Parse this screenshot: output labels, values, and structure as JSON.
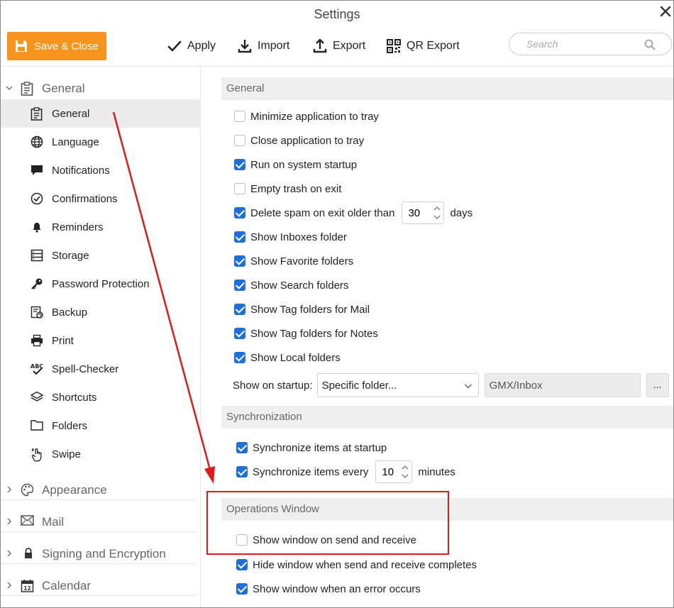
{
  "window": {
    "title": "Settings"
  },
  "toolbar": {
    "save_close": "Save & Close",
    "apply": "Apply",
    "import": "Import",
    "export": "Export",
    "qr_export": "QR Export"
  },
  "search": {
    "placeholder": "Search"
  },
  "colors": {
    "accent": "#f7941d",
    "checkbox": "#1e6fd9",
    "annotation": "#e0191b"
  },
  "sidebar": {
    "groups": [
      {
        "label": "General",
        "icon": "clipboard-icon",
        "expanded": true
      },
      {
        "label": "Appearance",
        "icon": "palette-icon",
        "expanded": false
      },
      {
        "label": "Mail",
        "icon": "envelope-icon",
        "expanded": false
      },
      {
        "label": "Signing and Encryption",
        "icon": "lock-icon",
        "expanded": false
      },
      {
        "label": "Calendar",
        "icon": "calendar-icon",
        "expanded": false
      }
    ],
    "items": [
      {
        "label": "General",
        "icon": "clipboard-icon",
        "selected": true
      },
      {
        "label": "Language",
        "icon": "globe-icon"
      },
      {
        "label": "Notifications",
        "icon": "speech-bubble-icon"
      },
      {
        "label": "Confirmations",
        "icon": "check-circle-icon"
      },
      {
        "label": "Reminders",
        "icon": "bell-icon"
      },
      {
        "label": "Storage",
        "icon": "storage-icon"
      },
      {
        "label": "Password Protection",
        "icon": "key-icon"
      },
      {
        "label": "Backup",
        "icon": "backup-icon"
      },
      {
        "label": "Print",
        "icon": "printer-icon"
      },
      {
        "label": "Spell-Checker",
        "icon": "spellcheck-icon"
      },
      {
        "label": "Shortcuts",
        "icon": "layers-icon"
      },
      {
        "label": "Folders",
        "icon": "folder-icon"
      },
      {
        "label": "Swipe",
        "icon": "swipe-hand-icon"
      }
    ],
    "calendar_icon_text": "12"
  },
  "general": {
    "heading": "General",
    "options": [
      {
        "label": "Minimize application to tray",
        "checked": false
      },
      {
        "label": "Close application to tray",
        "checked": false
      },
      {
        "label": "Run on system startup",
        "checked": true
      },
      {
        "label": "Empty trash on exit",
        "checked": false
      },
      {
        "label": "Delete spam on exit older than",
        "checked": true,
        "value": "30",
        "suffix": "days"
      },
      {
        "label": "Show Inboxes folder",
        "checked": true
      },
      {
        "label": "Show Favorite folders",
        "checked": true
      },
      {
        "label": "Show Search folders",
        "checked": true
      },
      {
        "label": "Show Tag folders for Mail",
        "checked": true
      },
      {
        "label": "Show Tag folders for Notes",
        "checked": true
      },
      {
        "label": "Show Local folders",
        "checked": true
      }
    ],
    "startup": {
      "label": "Show on startup:",
      "select_value": "Specific folder...",
      "folder_value": "GMX/Inbox",
      "browse_label": "..."
    }
  },
  "synchronization": {
    "heading": "Synchronization",
    "options": [
      {
        "label": "Synchronize items at startup",
        "checked": true
      },
      {
        "label": "Synchronize items every",
        "checked": true,
        "value": "10",
        "suffix": "minutes"
      }
    ]
  },
  "operations_window": {
    "heading": "Operations Window",
    "options": [
      {
        "label": "Show window on send and receive",
        "checked": false
      },
      {
        "label": "Hide window when send and receive completes",
        "checked": true
      },
      {
        "label": "Show window when an error occurs",
        "checked": true
      }
    ]
  }
}
